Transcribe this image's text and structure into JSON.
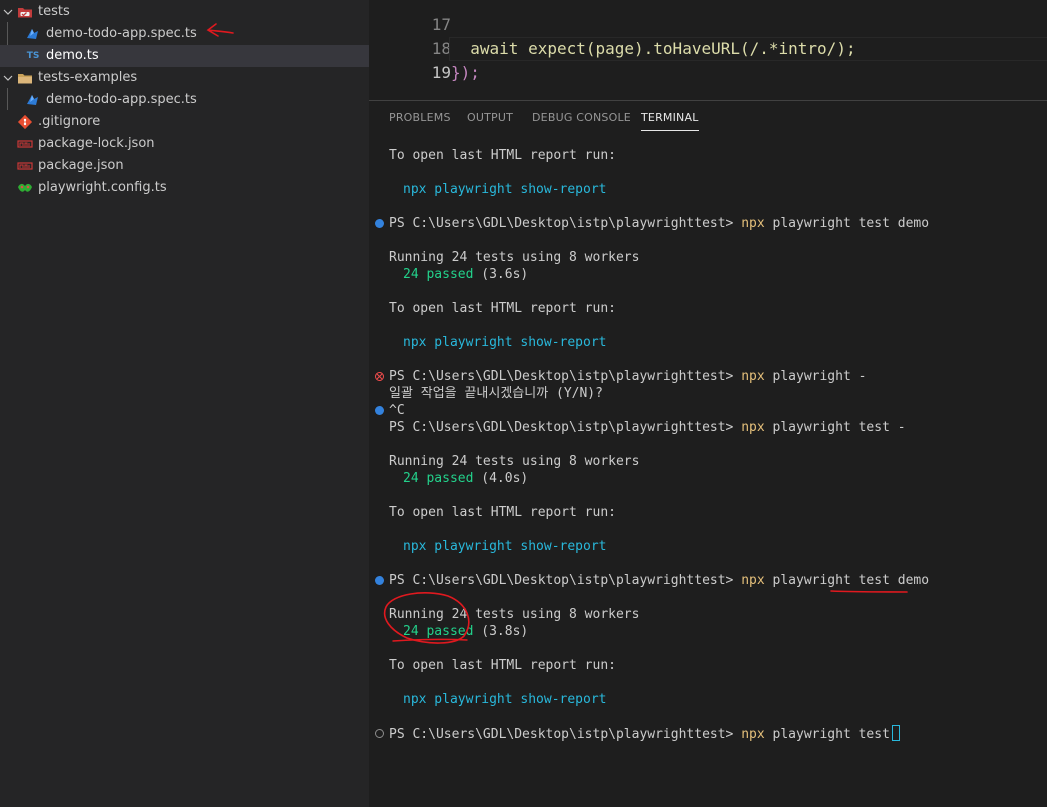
{
  "explorer": {
    "items": [
      {
        "label": "tests",
        "kind": "folder",
        "expanded": true,
        "icon": "tests-folder-icon"
      },
      {
        "label": "demo-todo-app.spec.ts",
        "kind": "file",
        "icon": "playwright-icon"
      },
      {
        "label": "demo.ts",
        "kind": "file",
        "icon": "typescript-icon",
        "icon_text": "TS",
        "selected": true
      },
      {
        "label": "tests-examples",
        "kind": "folder",
        "expanded": true,
        "icon": "folder-icon"
      },
      {
        "label": "demo-todo-app.spec.ts",
        "kind": "file",
        "icon": "playwright-icon"
      },
      {
        "label": ".gitignore",
        "kind": "file",
        "icon": "git-icon"
      },
      {
        "label": "package-lock.json",
        "kind": "file",
        "icon": "npm-icon"
      },
      {
        "label": "package.json",
        "kind": "file",
        "icon": "npm-icon"
      },
      {
        "label": "playwright.config.ts",
        "kind": "file",
        "icon": "playwright-config-icon"
      }
    ]
  },
  "editor": {
    "lines": [
      {
        "number": "17",
        "code": "  await expect(page).toHaveURL(/.*intro/);"
      },
      {
        "number": "18",
        "code": "});"
      },
      {
        "number": "19",
        "code": ""
      }
    ]
  },
  "panel": {
    "tabs": [
      "PROBLEMS",
      "OUTPUT",
      "DEBUG CONSOLE",
      "TERMINAL"
    ],
    "active_tab": "TERMINAL"
  },
  "terminal": {
    "lines": {
      "l1": "To open last HTML report run:",
      "l2": "npx playwright show-report",
      "l3_prompt": "PS C:\\Users\\GDL\\Desktop\\istp\\playwrighttest>",
      "l3_cmd": "npx",
      "l3_args": "playwright test demo",
      "l4": "Running 24 tests using 8 workers",
      "l5_passed": "24 passed",
      "l5_time": "(3.6s)",
      "l6": "To open last HTML report run:",
      "l7": "npx playwright show-report",
      "l8_prompt": "PS C:\\Users\\GDL\\Desktop\\istp\\playwrighttest>",
      "l8_cmd": "npx",
      "l8_args": "playwright -",
      "l9": "일괄 작업을 끝내시겠습니까 (Y/N)?",
      "l10": "^C",
      "l11_prompt": "PS C:\\Users\\GDL\\Desktop\\istp\\playwrighttest>",
      "l11_cmd": "npx",
      "l11_args": "playwright test -",
      "l12": "Running 24 tests using 8 workers",
      "l13_passed": "24 passed",
      "l13_time": "(4.0s)",
      "l14": "To open last HTML report run:",
      "l15": "npx playwright show-report",
      "l16_prompt": "PS C:\\Users\\GDL\\Desktop\\istp\\playwrighttest>",
      "l16_cmd": "npx",
      "l16_args": "playwright test demo",
      "l17": "Running 24 tests using 8 workers",
      "l18_passed": "24 passed",
      "l18_time": "(3.8s)",
      "l19": "To open last HTML report run:",
      "l20": "npx playwright show-report",
      "l21_prompt": "PS C:\\Users\\GDL\\Desktop\\istp\\playwrighttest>",
      "l21_cmd": "npx",
      "l21_args": "playwright test"
    }
  },
  "colors": {
    "sidebar_bg": "#252526",
    "editor_bg": "#1e1e1e",
    "selected_row": "#37373d",
    "terminal_command": "#e5c07b",
    "terminal_cyan": "#29b8db",
    "terminal_green": "#23d18b",
    "annotation_red": "#e0191f"
  }
}
